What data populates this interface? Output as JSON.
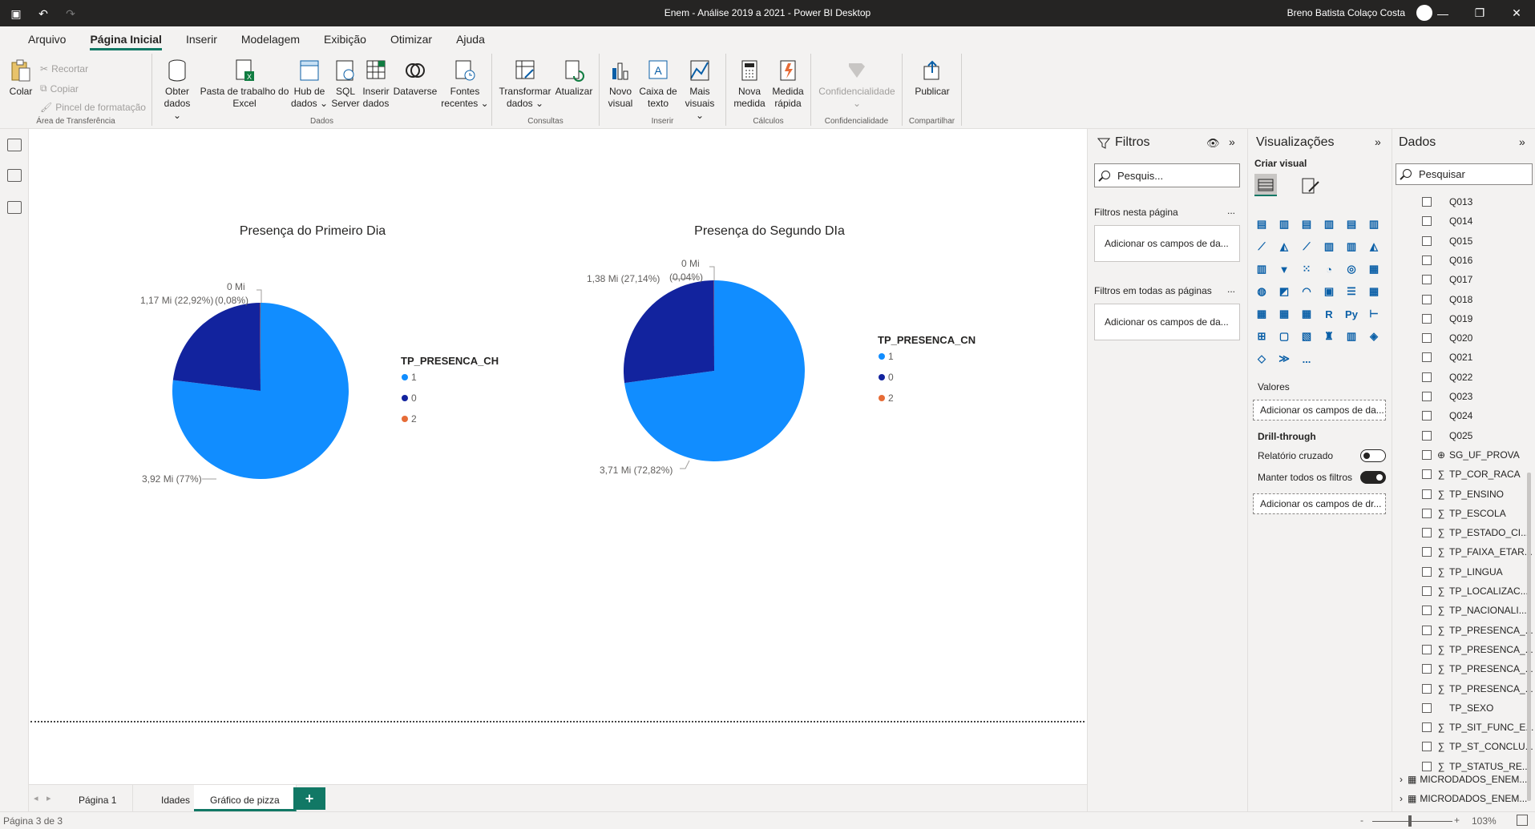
{
  "window": {
    "title": "Enem - Análise 2019 a 2021 - Power BI Desktop",
    "user": "Breno Batista Colaço Costa"
  },
  "menu": [
    "Arquivo",
    "Página Inicial",
    "Inserir",
    "Modelagem",
    "Exibição",
    "Otimizar",
    "Ajuda"
  ],
  "ribbon": {
    "clipboard": {
      "paste": "Colar",
      "cut": "Recortar",
      "copy": "Copiar",
      "format_painter": "Pincel de formatação",
      "group": "Área de Transferência"
    },
    "data": {
      "get_data_1": "Obter",
      "get_data_2": "dados ⌄",
      "excel_1": "Pasta de trabalho do",
      "excel_2": "Excel",
      "hub_1": "Hub de",
      "hub_2": "dados ⌄",
      "sql_1": "SQL",
      "sql_2": "Server",
      "enter_1": "Inserir",
      "enter_2": "dados",
      "dataverse": "Dataverse",
      "recent_1": "Fontes",
      "recent_2": "recentes ⌄",
      "group": "Dados"
    },
    "queries": {
      "transform_1": "Transformar",
      "transform_2": "dados ⌄",
      "refresh": "Atualizar",
      "group": "Consultas"
    },
    "insert": {
      "new_visual_1": "Novo",
      "new_visual_2": "visual",
      "textbox_1": "Caixa de",
      "textbox_2": "texto",
      "more_1": "Mais",
      "more_2": "visuais ⌄",
      "group": "Inserir"
    },
    "calc": {
      "measure_1": "Nova",
      "measure_2": "medida",
      "quick_1": "Medida",
      "quick_2": "rápida",
      "group": "Cálculos"
    },
    "sensitivity": {
      "label": "Confidencialidade",
      "caret": "⌄",
      "group": "Confidencialidade"
    },
    "share": {
      "publish": "Publicar",
      "group": "Compartilhar"
    }
  },
  "chart_data": [
    {
      "type": "pie",
      "title": "Presença do Primeiro Dia",
      "legend_title": "TP_PRESENCA_CH",
      "categories": [
        "1",
        "0",
        "2"
      ],
      "values": [
        3.92,
        1.17,
        0.004
      ],
      "percent_labels": [
        "3,92 Mi (77%)",
        "1,17 Mi (22,92%)",
        "0 Mi",
        "(0,08%)"
      ],
      "colors": [
        "#118DFF",
        "#12239E",
        "#E66C37"
      ]
    },
    {
      "type": "pie",
      "title": "Presença do Segundo DIa",
      "legend_title": "TP_PRESENCA_CN",
      "categories": [
        "1",
        "0",
        "2"
      ],
      "values": [
        3.71,
        1.38,
        0.002
      ],
      "percent_labels": [
        "3,71 Mi (72,82%)",
        "1,38 Mi (27,14%)",
        "0 Mi",
        "(0,04%)"
      ],
      "colors": [
        "#118DFF",
        "#12239E",
        "#E66C37"
      ]
    }
  ],
  "tabs": [
    "Página 1",
    "Idades",
    "Gráfico de pizza"
  ],
  "tab_add": "+",
  "status": {
    "page": "Página 3 de 3",
    "zoom": "103%",
    "minus": "-",
    "plus": "+"
  },
  "filters": {
    "title": "Filtros",
    "search": "Pesquis...",
    "this_page": "Filtros nesta página",
    "this_page_well": "Adicionar os campos de da...",
    "all_pages": "Filtros em todas as páginas",
    "all_pages_well": "Adicionar os campos de da...",
    "more": "..."
  },
  "visualizations": {
    "title": "Visualizações",
    "build": "Criar visual",
    "r_label": "R",
    "py_label": "Py",
    "more": "...",
    "values_label": "Valores",
    "values_well": "Adicionar os campos de da...",
    "drill_label": "Drill-through",
    "cross_report": "Relatório cruzado",
    "keep_filters": "Manter todos os filtros",
    "drill_well": "Adicionar os campos de dr..."
  },
  "data_pane": {
    "title": "Dados",
    "search": "Pesquisar",
    "fields": [
      {
        "name": "Q013",
        "kind": "none"
      },
      {
        "name": "Q014",
        "kind": "none"
      },
      {
        "name": "Q015",
        "kind": "none"
      },
      {
        "name": "Q016",
        "kind": "none"
      },
      {
        "name": "Q017",
        "kind": "none"
      },
      {
        "name": "Q018",
        "kind": "none"
      },
      {
        "name": "Q019",
        "kind": "none"
      },
      {
        "name": "Q020",
        "kind": "none"
      },
      {
        "name": "Q021",
        "kind": "none"
      },
      {
        "name": "Q022",
        "kind": "none"
      },
      {
        "name": "Q023",
        "kind": "none"
      },
      {
        "name": "Q024",
        "kind": "none"
      },
      {
        "name": "Q025",
        "kind": "none"
      },
      {
        "name": "SG_UF_PROVA",
        "kind": "globe"
      },
      {
        "name": "TP_COR_RACA",
        "kind": "sigma"
      },
      {
        "name": "TP_ENSINO",
        "kind": "sigma"
      },
      {
        "name": "TP_ESCOLA",
        "kind": "sigma"
      },
      {
        "name": "TP_ESTADO_CI...",
        "kind": "sigma"
      },
      {
        "name": "TP_FAIXA_ETAR...",
        "kind": "sigma"
      },
      {
        "name": "TP_LINGUA",
        "kind": "sigma"
      },
      {
        "name": "TP_LOCALIZAC...",
        "kind": "sigma"
      },
      {
        "name": "TP_NACIONALI...",
        "kind": "sigma"
      },
      {
        "name": "TP_PRESENCA_...",
        "kind": "sigma"
      },
      {
        "name": "TP_PRESENCA_...",
        "kind": "sigma"
      },
      {
        "name": "TP_PRESENCA_...",
        "kind": "sigma"
      },
      {
        "name": "TP_PRESENCA_...",
        "kind": "sigma"
      },
      {
        "name": "TP_SEXO",
        "kind": "none"
      },
      {
        "name": "TP_SIT_FUNC_E...",
        "kind": "sigma"
      },
      {
        "name": "TP_ST_CONCLU...",
        "kind": "sigma"
      },
      {
        "name": "TP_STATUS_RE...",
        "kind": "sigma"
      }
    ],
    "tables": [
      "MICRODADOS_ENEM...",
      "MICRODADOS_ENEM..."
    ]
  }
}
